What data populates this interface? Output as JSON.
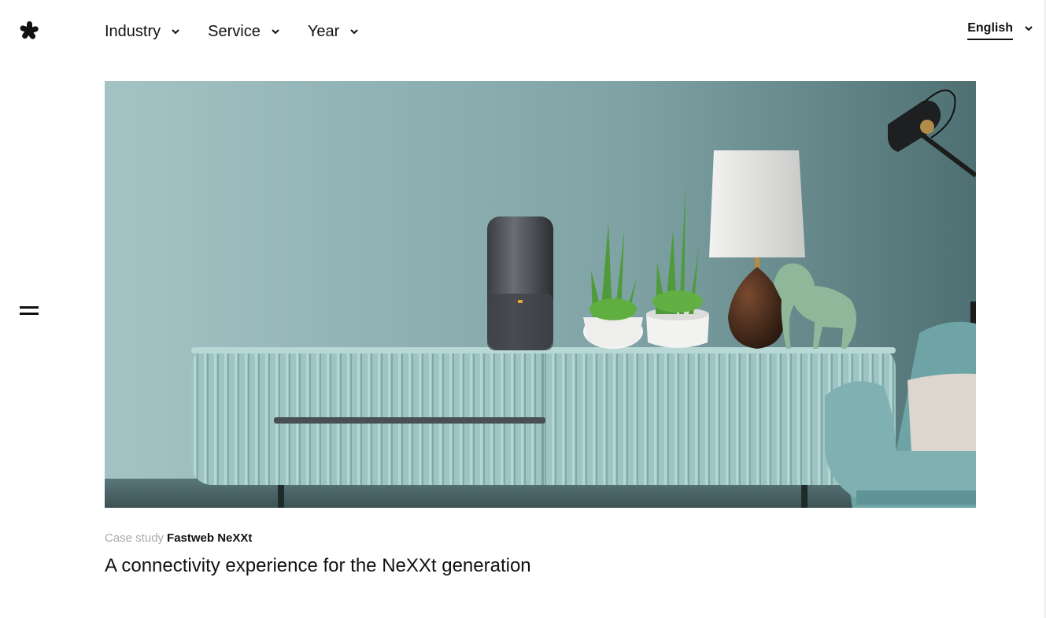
{
  "header": {
    "logo_icon": "asterisk-logo-icon",
    "nav": [
      {
        "label": "Industry",
        "icon": "chevron-down-icon"
      },
      {
        "label": "Service",
        "icon": "chevron-down-icon"
      },
      {
        "label": "Year",
        "icon": "chevron-down-icon"
      }
    ],
    "language": {
      "label": "English",
      "icon": "chevron-down-icon"
    }
  },
  "sidebar": {
    "menu_icon": "hamburger-menu-icon"
  },
  "main": {
    "project": {
      "kicker": "Case study",
      "client": "Fastweb NeXXt",
      "headline": "A connectivity experience for the NeXXt generation"
    }
  },
  "colors": {
    "wall": "#8fb2b3",
    "sideboard": "#9fc7c6",
    "text": "#111111",
    "muted": "#a9a9a9"
  }
}
